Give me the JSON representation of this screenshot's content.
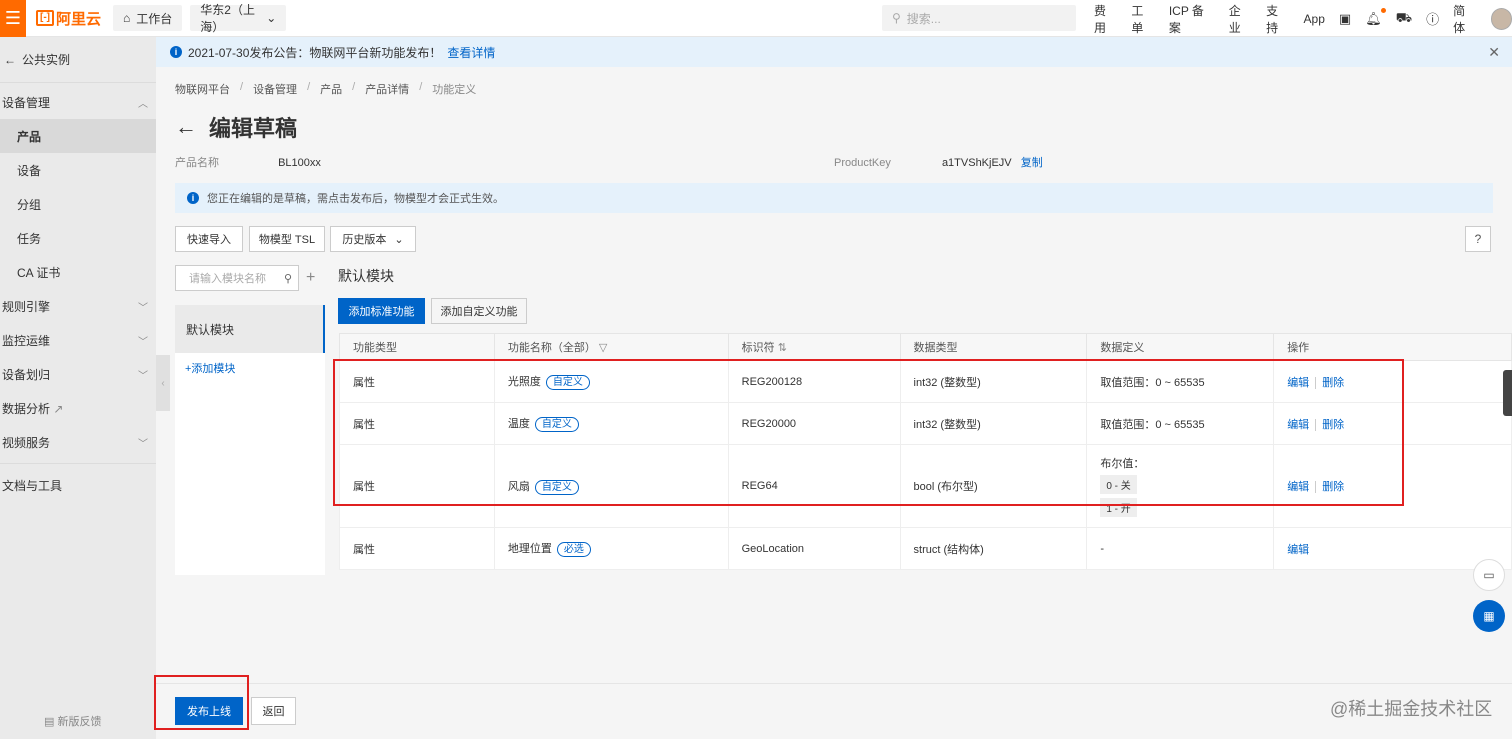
{
  "topbar": {
    "logo_text": "阿里云",
    "logo_mark": "[-]",
    "workbench": "工作台",
    "region": "华东2（上海）",
    "search_placeholder": "搜索...",
    "links": [
      "费用",
      "工单",
      "ICP 备案",
      "企业",
      "支持",
      "App"
    ],
    "lang": "简体"
  },
  "sidebar": {
    "back_label": "公共实例",
    "group_device_mgmt": "设备管理",
    "items": [
      "产品",
      "设备",
      "分组",
      "任务",
      "CA 证书"
    ],
    "groups": [
      "规则引擎",
      "监控运维",
      "设备划归",
      "数据分析",
      "视频服务"
    ],
    "docs": "文档与工具",
    "feedback": "新版反馈"
  },
  "notice": {
    "text": "2021-07-30发布公告：物联网平台新功能发布！",
    "link": "查看详情"
  },
  "breadcrumb": [
    "物联网平台",
    "设备管理",
    "产品",
    "产品详情",
    "功能定义"
  ],
  "page": {
    "title": "编辑草稿",
    "product_name_label": "产品名称",
    "product_name": "BL100xx",
    "product_key_label": "ProductKey",
    "product_key": "a1TVShKjEJV",
    "copy_label": "复制",
    "draft_alert": "您正在编辑的是草稿，需点击发布后，物模型才会正式生效。"
  },
  "toolbar": {
    "quick_import": "快速导入",
    "tsl": "物模型 TSL",
    "history": "历史版本",
    "help": "?"
  },
  "modules": {
    "search_placeholder": "请输入模块名称",
    "default_module": "默认模块",
    "add_module": "+添加模块"
  },
  "section": {
    "title": "默认模块",
    "add_standard": "添加标准功能",
    "add_custom": "添加自定义功能"
  },
  "table": {
    "headers": [
      "功能类型",
      "功能名称（全部）",
      "标识符",
      "数据类型",
      "数据定义",
      "操作"
    ],
    "rows": [
      {
        "type": "属性",
        "name": "光照度",
        "tag": "自定义",
        "identifier": "REG200128",
        "data_type": "int32 (整数型)",
        "definition": "取值范围：0 ~ 65535",
        "edit": "编辑",
        "delete": "删除"
      },
      {
        "type": "属性",
        "name": "温度",
        "tag": "自定义",
        "identifier": "REG20000",
        "data_type": "int32 (整数型)",
        "definition": "取值范围：0 ~ 65535",
        "edit": "编辑",
        "delete": "删除"
      },
      {
        "type": "属性",
        "name": "风扇",
        "tag": "自定义",
        "identifier": "REG64",
        "data_type": "bool (布尔型)",
        "definition": "布尔值：",
        "bool_0": "0 - 关",
        "bool_1": "1 - 开",
        "edit": "编辑",
        "delete": "删除"
      },
      {
        "type": "属性",
        "name": "地理位置",
        "tag": "必选",
        "identifier": "GeoLocation",
        "data_type": "struct (结构体)",
        "definition": "-",
        "edit": "编辑"
      }
    ]
  },
  "footer": {
    "publish": "发布上线",
    "back": "返回",
    "watermark": "@稀土掘金技术社区"
  },
  "colors": {
    "brand": "#ff6a00",
    "primary": "#0064c8",
    "highlight": "#e02020"
  }
}
